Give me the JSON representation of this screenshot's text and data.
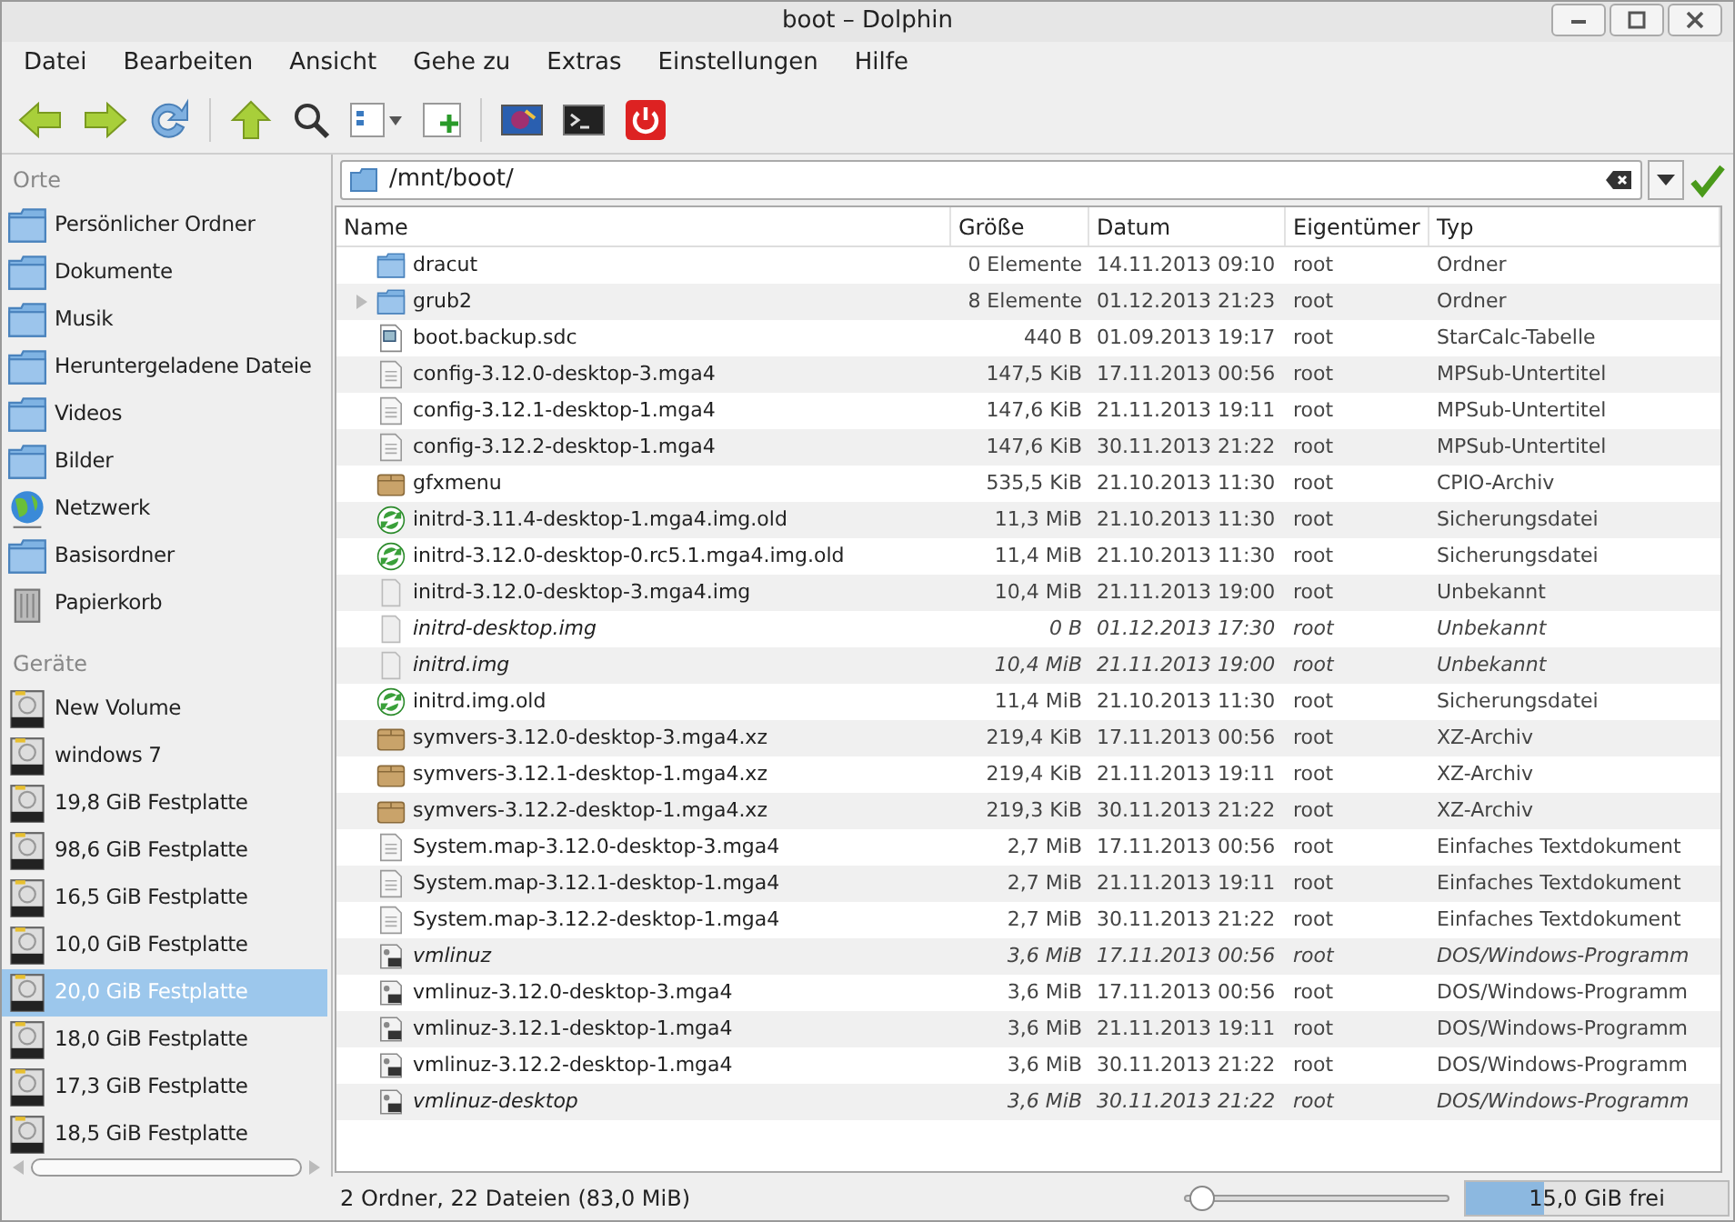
{
  "window": {
    "title": "boot – Dolphin"
  },
  "menu": [
    "Datei",
    "Bearbeiten",
    "Ansicht",
    "Gehe zu",
    "Extras",
    "Einstellungen",
    "Hilfe"
  ],
  "sidebar": {
    "sections": [
      {
        "title": "Orte",
        "items": [
          {
            "label": "Persönlicher Ordner",
            "kind": "folder",
            "selected": false
          },
          {
            "label": "Dokumente",
            "kind": "folder",
            "selected": false
          },
          {
            "label": "Musik",
            "kind": "folder",
            "selected": false
          },
          {
            "label": "Heruntergeladene Dateie",
            "kind": "folder",
            "selected": false
          },
          {
            "label": "Videos",
            "kind": "folder",
            "selected": false
          },
          {
            "label": "Bilder",
            "kind": "folder",
            "selected": false
          },
          {
            "label": "Netzwerk",
            "kind": "globe",
            "selected": false
          },
          {
            "label": "Basisordner",
            "kind": "folder",
            "selected": false
          },
          {
            "label": "Papierkorb",
            "kind": "trash",
            "selected": false
          }
        ]
      },
      {
        "title": "Geräte",
        "items": [
          {
            "label": "New Volume",
            "kind": "drive",
            "selected": false
          },
          {
            "label": "windows 7",
            "kind": "drive",
            "selected": false
          },
          {
            "label": "19,8 GiB Festplatte",
            "kind": "drive",
            "selected": false
          },
          {
            "label": "98,6 GiB Festplatte",
            "kind": "drive",
            "selected": false
          },
          {
            "label": "16,5 GiB Festplatte",
            "kind": "drive",
            "selected": false
          },
          {
            "label": "10,0 GiB Festplatte",
            "kind": "drive",
            "selected": false
          },
          {
            "label": "20,0 GiB Festplatte",
            "kind": "drive",
            "selected": true
          },
          {
            "label": "18,0 GiB Festplatte",
            "kind": "drive",
            "selected": false
          },
          {
            "label": "17,3 GiB Festplatte",
            "kind": "drive",
            "selected": false
          },
          {
            "label": "18,5 GiB Festplatte",
            "kind": "drive",
            "selected": false
          }
        ]
      }
    ]
  },
  "location": {
    "path": "/mnt/boot/"
  },
  "table": {
    "columns": [
      "Name",
      "Größe",
      "Datum",
      "Eigentümer",
      "Typ"
    ],
    "rows": [
      {
        "kind": "folder",
        "expandable": false,
        "link": false,
        "cells": [
          "dracut",
          "0 Elemente",
          "14.11.2013 09:10",
          "root",
          "Ordner"
        ]
      },
      {
        "kind": "folder",
        "expandable": true,
        "link": false,
        "cells": [
          "grub2",
          "8 Elemente",
          "01.12.2013 21:23",
          "root",
          "Ordner"
        ]
      },
      {
        "kind": "spreadsheet",
        "expandable": false,
        "link": false,
        "cells": [
          "boot.backup.sdc",
          "440 B",
          "01.09.2013 19:17",
          "root",
          "StarCalc-Tabelle"
        ]
      },
      {
        "kind": "text",
        "expandable": false,
        "link": false,
        "cells": [
          "config-3.12.0-desktop-3.mga4",
          "147,5 KiB",
          "17.11.2013 00:56",
          "root",
          "MPSub-Untertitel"
        ]
      },
      {
        "kind": "text",
        "expandable": false,
        "link": false,
        "cells": [
          "config-3.12.1-desktop-1.mga4",
          "147,6 KiB",
          "21.11.2013 19:11",
          "root",
          "MPSub-Untertitel"
        ]
      },
      {
        "kind": "text",
        "expandable": false,
        "link": false,
        "cells": [
          "config-3.12.2-desktop-1.mga4",
          "147,6 KiB",
          "30.11.2013 21:22",
          "root",
          "MPSub-Untertitel"
        ]
      },
      {
        "kind": "archive",
        "expandable": false,
        "link": false,
        "cells": [
          "gfxmenu",
          "535,5 KiB",
          "21.10.2013 11:30",
          "root",
          "CPIO-Archiv"
        ]
      },
      {
        "kind": "backup",
        "expandable": false,
        "link": false,
        "cells": [
          "initrd-3.11.4-desktop-1.mga4.img.old",
          "11,3 MiB",
          "21.10.2013 11:30",
          "root",
          "Sicherungsdatei"
        ]
      },
      {
        "kind": "backup",
        "expandable": false,
        "link": false,
        "cells": [
          "initrd-3.12.0-desktop-0.rc5.1.mga4.img.old",
          "11,4 MiB",
          "21.10.2013 11:30",
          "root",
          "Sicherungsdatei"
        ]
      },
      {
        "kind": "blank",
        "expandable": false,
        "link": false,
        "cells": [
          "initrd-3.12.0-desktop-3.mga4.img",
          "10,4 MiB",
          "21.11.2013 19:00",
          "root",
          "Unbekannt"
        ]
      },
      {
        "kind": "blank",
        "expandable": false,
        "link": true,
        "cells": [
          "initrd-desktop.img",
          "0 B",
          "01.12.2013 17:30",
          "root",
          "Unbekannt"
        ]
      },
      {
        "kind": "blank",
        "expandable": false,
        "link": true,
        "cells": [
          "initrd.img",
          "10,4 MiB",
          "21.11.2013 19:00",
          "root",
          "Unbekannt"
        ]
      },
      {
        "kind": "backup",
        "expandable": false,
        "link": false,
        "cells": [
          "initrd.img.old",
          "11,4 MiB",
          "21.10.2013 11:30",
          "root",
          "Sicherungsdatei"
        ]
      },
      {
        "kind": "archive",
        "expandable": false,
        "link": false,
        "cells": [
          "symvers-3.12.0-desktop-3.mga4.xz",
          "219,4 KiB",
          "17.11.2013 00:56",
          "root",
          "XZ-Archiv"
        ]
      },
      {
        "kind": "archive",
        "expandable": false,
        "link": false,
        "cells": [
          "symvers-3.12.1-desktop-1.mga4.xz",
          "219,4 KiB",
          "21.11.2013 19:11",
          "root",
          "XZ-Archiv"
        ]
      },
      {
        "kind": "archive",
        "expandable": false,
        "link": false,
        "cells": [
          "symvers-3.12.2-desktop-1.mga4.xz",
          "219,3 KiB",
          "30.11.2013 21:22",
          "root",
          "XZ-Archiv"
        ]
      },
      {
        "kind": "text",
        "expandable": false,
        "link": false,
        "cells": [
          "System.map-3.12.0-desktop-3.mga4",
          "2,7 MiB",
          "17.11.2013 00:56",
          "root",
          "Einfaches Textdokument"
        ]
      },
      {
        "kind": "text",
        "expandable": false,
        "link": false,
        "cells": [
          "System.map-3.12.1-desktop-1.mga4",
          "2,7 MiB",
          "21.11.2013 19:11",
          "root",
          "Einfaches Textdokument"
        ]
      },
      {
        "kind": "text",
        "expandable": false,
        "link": false,
        "cells": [
          "System.map-3.12.2-desktop-1.mga4",
          "2,7 MiB",
          "30.11.2013 21:22",
          "root",
          "Einfaches Textdokument"
        ]
      },
      {
        "kind": "exec",
        "expandable": false,
        "link": true,
        "cells": [
          "vmlinuz",
          "3,6 MiB",
          "17.11.2013 00:56",
          "root",
          "DOS/Windows-Programm"
        ]
      },
      {
        "kind": "exec",
        "expandable": false,
        "link": false,
        "cells": [
          "vmlinuz-3.12.0-desktop-3.mga4",
          "3,6 MiB",
          "17.11.2013 00:56",
          "root",
          "DOS/Windows-Programm"
        ]
      },
      {
        "kind": "exec",
        "expandable": false,
        "link": false,
        "cells": [
          "vmlinuz-3.12.1-desktop-1.mga4",
          "3,6 MiB",
          "21.11.2013 19:11",
          "root",
          "DOS/Windows-Programm"
        ]
      },
      {
        "kind": "exec",
        "expandable": false,
        "link": false,
        "cells": [
          "vmlinuz-3.12.2-desktop-1.mga4",
          "3,6 MiB",
          "30.11.2013 21:22",
          "root",
          "DOS/Windows-Programm"
        ]
      },
      {
        "kind": "exec",
        "expandable": false,
        "link": true,
        "cells": [
          "vmlinuz-desktop",
          "3,6 MiB",
          "30.11.2013 21:22",
          "root",
          "DOS/Windows-Programm"
        ]
      }
    ]
  },
  "status_bar": {
    "text": "2 Ordner, 22 Dateien (83,0 MiB)",
    "zoom": {
      "level": 0.02
    },
    "free_space": {
      "text": "15,0 GiB frei",
      "level": 0.3
    }
  }
}
